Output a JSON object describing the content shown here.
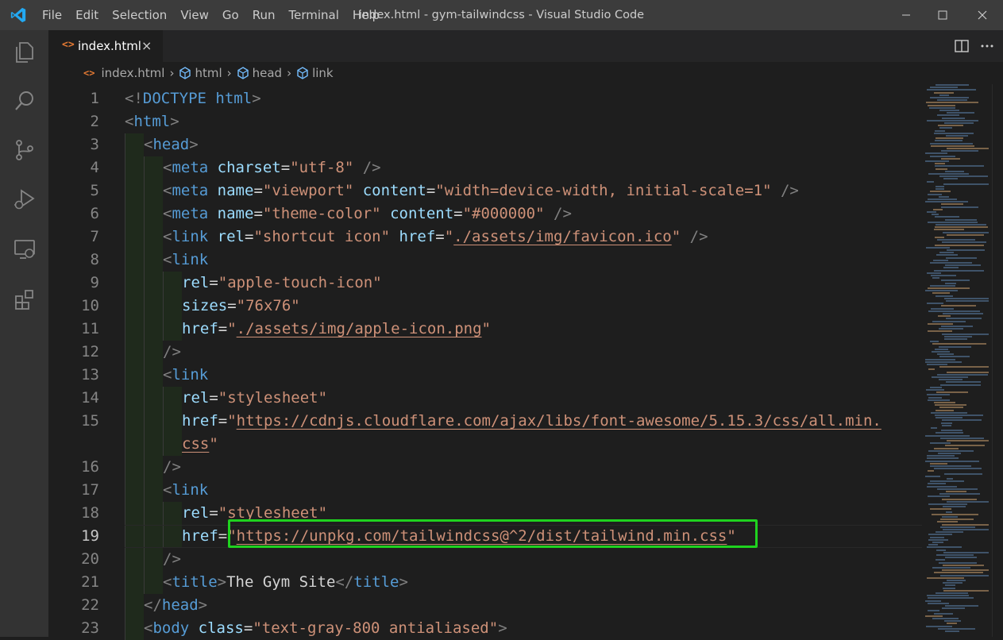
{
  "window": {
    "title": "index.html - gym-tailwindcss - Visual Studio Code"
  },
  "menu": [
    "File",
    "Edit",
    "Selection",
    "View",
    "Go",
    "Run",
    "Terminal",
    "Help"
  ],
  "activity_bar": [
    "explorer-icon",
    "search-icon",
    "source-control-icon",
    "run-debug-icon",
    "remote-explorer-icon",
    "extensions-icon"
  ],
  "tab": {
    "label": "index.html",
    "close": "×"
  },
  "breadcrumb": {
    "file": "index.html",
    "items": [
      "html",
      "head",
      "link"
    ]
  },
  "editor": {
    "active_line": 19,
    "lines": [
      {
        "n": "1",
        "tokens": [
          [
            "br",
            "<!"
          ],
          [
            "tag",
            "DOCTYPE"
          ],
          [
            "txt",
            " "
          ],
          [
            "tag",
            "html"
          ],
          [
            "br",
            ">"
          ]
        ]
      },
      {
        "n": "2",
        "tokens": [
          [
            "br",
            "<"
          ],
          [
            "tag",
            "html"
          ],
          [
            "br",
            ">"
          ]
        ]
      },
      {
        "n": "3",
        "indent": 1,
        "tokens": [
          [
            "br",
            "<"
          ],
          [
            "tag",
            "head"
          ],
          [
            "br",
            ">"
          ]
        ]
      },
      {
        "n": "4",
        "indent": 2,
        "tokens": [
          [
            "br",
            "<"
          ],
          [
            "tag",
            "meta"
          ],
          [
            "txt",
            " "
          ],
          [
            "attr",
            "charset"
          ],
          [
            "txt",
            "="
          ],
          [
            "str",
            "\"utf-8\""
          ],
          [
            "txt",
            " "
          ],
          [
            "br",
            "/>"
          ]
        ]
      },
      {
        "n": "5",
        "indent": 2,
        "tokens": [
          [
            "br",
            "<"
          ],
          [
            "tag",
            "meta"
          ],
          [
            "txt",
            " "
          ],
          [
            "attr",
            "name"
          ],
          [
            "txt",
            "="
          ],
          [
            "str",
            "\"viewport\""
          ],
          [
            "txt",
            " "
          ],
          [
            "attr",
            "content"
          ],
          [
            "txt",
            "="
          ],
          [
            "str",
            "\"width=device-width, initial-scale=1\""
          ],
          [
            "txt",
            " "
          ],
          [
            "br",
            "/>"
          ]
        ]
      },
      {
        "n": "6",
        "indent": 2,
        "tokens": [
          [
            "br",
            "<"
          ],
          [
            "tag",
            "meta"
          ],
          [
            "txt",
            " "
          ],
          [
            "attr",
            "name"
          ],
          [
            "txt",
            "="
          ],
          [
            "str",
            "\"theme-color\""
          ],
          [
            "txt",
            " "
          ],
          [
            "attr",
            "content"
          ],
          [
            "txt",
            "="
          ],
          [
            "str",
            "\"#000000\""
          ],
          [
            "txt",
            " "
          ],
          [
            "br",
            "/>"
          ]
        ]
      },
      {
        "n": "7",
        "indent": 2,
        "tokens": [
          [
            "br",
            "<"
          ],
          [
            "tag",
            "link"
          ],
          [
            "txt",
            " "
          ],
          [
            "attr",
            "rel"
          ],
          [
            "txt",
            "="
          ],
          [
            "str",
            "\"shortcut icon\""
          ],
          [
            "txt",
            " "
          ],
          [
            "attr",
            "href"
          ],
          [
            "txt",
            "="
          ],
          [
            "str",
            "\""
          ],
          [
            "link",
            "./assets/img/favicon.ico"
          ],
          [
            "str",
            "\""
          ],
          [
            "txt",
            " "
          ],
          [
            "br",
            "/>"
          ]
        ]
      },
      {
        "n": "8",
        "indent": 2,
        "tokens": [
          [
            "br",
            "<"
          ],
          [
            "tag",
            "link"
          ]
        ]
      },
      {
        "n": "9",
        "indent": 3,
        "tokens": [
          [
            "attr",
            "rel"
          ],
          [
            "txt",
            "="
          ],
          [
            "str",
            "\"apple-touch-icon\""
          ]
        ]
      },
      {
        "n": "10",
        "indent": 3,
        "tokens": [
          [
            "attr",
            "sizes"
          ],
          [
            "txt",
            "="
          ],
          [
            "str",
            "\"76x76\""
          ]
        ]
      },
      {
        "n": "11",
        "indent": 3,
        "tokens": [
          [
            "attr",
            "href"
          ],
          [
            "txt",
            "="
          ],
          [
            "str",
            "\""
          ],
          [
            "link",
            "./assets/img/apple-icon.png"
          ],
          [
            "str",
            "\""
          ]
        ]
      },
      {
        "n": "12",
        "indent": 2,
        "tokens": [
          [
            "br",
            "/>"
          ]
        ]
      },
      {
        "n": "13",
        "indent": 2,
        "tokens": [
          [
            "br",
            "<"
          ],
          [
            "tag",
            "link"
          ]
        ]
      },
      {
        "n": "14",
        "indent": 3,
        "tokens": [
          [
            "attr",
            "rel"
          ],
          [
            "txt",
            "="
          ],
          [
            "str",
            "\"stylesheet\""
          ]
        ]
      },
      {
        "n": "15",
        "indent": 3,
        "tokens": [
          [
            "attr",
            "href"
          ],
          [
            "txt",
            "="
          ],
          [
            "str",
            "\""
          ],
          [
            "link",
            "https://cdnjs.cloudflare.com/ajax/libs/font-awesome/5.15.3/css/all.min."
          ]
        ]
      },
      {
        "n": "",
        "indent": 3,
        "tokens": [
          [
            "link",
            "css"
          ],
          [
            "str",
            "\""
          ]
        ]
      },
      {
        "n": "16",
        "indent": 2,
        "tokens": [
          [
            "br",
            "/>"
          ]
        ]
      },
      {
        "n": "17",
        "indent": 2,
        "tokens": [
          [
            "br",
            "<"
          ],
          [
            "tag",
            "link"
          ]
        ]
      },
      {
        "n": "18",
        "indent": 3,
        "tokens": [
          [
            "attr",
            "rel"
          ],
          [
            "txt",
            "="
          ],
          [
            "str",
            "\"stylesheet\""
          ]
        ]
      },
      {
        "n": "19",
        "indent": 3,
        "tokens": [
          [
            "attr",
            "href"
          ],
          [
            "txt",
            "="
          ],
          [
            "str",
            "\""
          ],
          [
            "link",
            "https://unpkg.com/tailwindcss@^2/dist/tailwind.min.css"
          ],
          [
            "str",
            "\""
          ]
        ]
      },
      {
        "n": "20",
        "indent": 2,
        "tokens": [
          [
            "br",
            "/>"
          ]
        ]
      },
      {
        "n": "21",
        "indent": 2,
        "tokens": [
          [
            "br",
            "<"
          ],
          [
            "tag",
            "title"
          ],
          [
            "br",
            ">"
          ],
          [
            "txt",
            "The Gym Site"
          ],
          [
            "br",
            "</"
          ],
          [
            "tag",
            "title"
          ],
          [
            "br",
            ">"
          ]
        ]
      },
      {
        "n": "22",
        "indent": 1,
        "tokens": [
          [
            "br",
            "</"
          ],
          [
            "tag",
            "head"
          ],
          [
            "br",
            ">"
          ]
        ]
      },
      {
        "n": "23",
        "indent": 1,
        "tokens": [
          [
            "br",
            "<"
          ],
          [
            "tag",
            "body"
          ],
          [
            "txt",
            " "
          ],
          [
            "attr",
            "class"
          ],
          [
            "txt",
            "="
          ],
          [
            "str",
            "\"text-gray-800 antialiased\""
          ],
          [
            "br",
            ">"
          ]
        ]
      }
    ]
  },
  "colors": {
    "titlebar": "#3c3c3c",
    "activity_bar": "#333333",
    "editor_bg": "#1e1e1e",
    "highlight_box": "#1fd21f"
  }
}
